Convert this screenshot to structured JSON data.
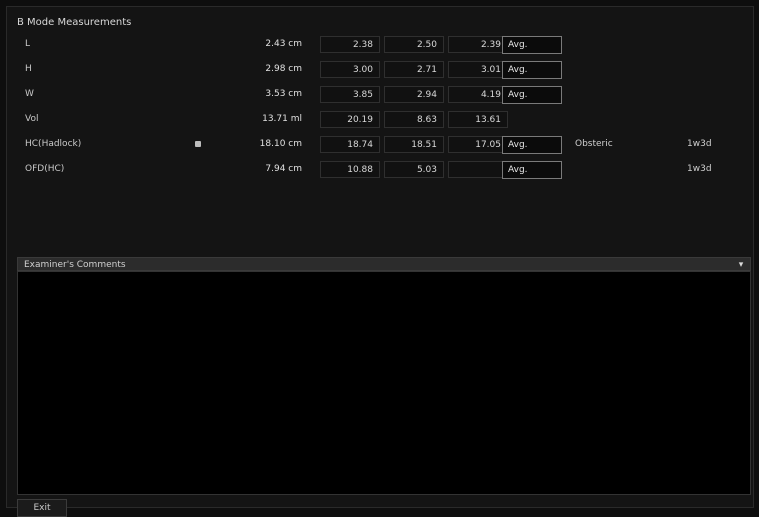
{
  "panel": {
    "title": "B Mode Measurements"
  },
  "rows": [
    {
      "label": "L",
      "value": "2.43 cm",
      "m1": "2.38",
      "m2": "2.50",
      "m3": "2.39",
      "avg": "Avg."
    },
    {
      "label": "H",
      "value": "2.98 cm",
      "m1": "3.00",
      "m2": "2.71",
      "m3": "3.01",
      "avg": "Avg."
    },
    {
      "label": "W",
      "value": "3.53 cm",
      "m1": "3.85",
      "m2": "2.94",
      "m3": "4.19",
      "avg": "Avg."
    },
    {
      "label": "Vol",
      "value": "13.71 ml",
      "m1": "20.19",
      "m2": "8.63",
      "m3": "13.61",
      "avg": ""
    },
    {
      "label": "HC(Hadlock)",
      "value": "18.10 cm",
      "m1": "18.74",
      "m2": "18.51",
      "m3": "17.05",
      "avg": "Avg.",
      "author": "Obsteric",
      "range": "1w3d"
    },
    {
      "label": "OFD(HC)",
      "value": "7.94 cm",
      "m1": "10.88",
      "m2": "5.03",
      "m3": "",
      "avg": "Avg.",
      "range": "1w3d"
    }
  ],
  "comments": {
    "title": "Examiner's Comments",
    "close_icon": "▾",
    "text": ""
  },
  "footer": {
    "exit_label": "Exit"
  }
}
